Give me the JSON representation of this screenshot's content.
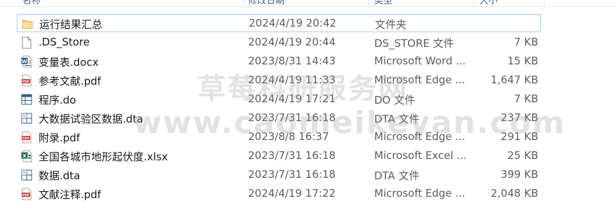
{
  "header": {
    "name": "名称",
    "date": "修改日期",
    "type": "类型",
    "size": "大小"
  },
  "files": [
    {
      "name": "运行结果汇总",
      "date": "2024/4/19 20:42",
      "type": "文件夹",
      "size": "",
      "icon": "folder-icon",
      "selected": true
    },
    {
      "name": ".DS_Store",
      "date": "2024/4/19 20:44",
      "type": "DS_STORE 文件",
      "size": "7 KB",
      "icon": "blank-file-icon"
    },
    {
      "name": "变量表.docx",
      "date": "2023/8/31 14:43",
      "type": "Microsoft Word ...",
      "size": "15 KB",
      "icon": "word-icon"
    },
    {
      "name": "参考文献.pdf",
      "date": "2024/4/19 11:33",
      "type": "Microsoft Edge ...",
      "size": "1,647 KB",
      "icon": "pdf-icon"
    },
    {
      "name": "程序.do",
      "date": "2024/4/19 17:21",
      "type": "DO 文件",
      "size": "7 KB",
      "icon": "stata-do-icon"
    },
    {
      "name": "大数据试验区数据.dta",
      "date": "2023/7/31 16:18",
      "type": "DTA 文件",
      "size": "237 KB",
      "icon": "stata-dta-icon"
    },
    {
      "name": "附录.pdf",
      "date": "2023/8/8 16:37",
      "type": "Microsoft Edge ...",
      "size": "291 KB",
      "icon": "pdf-icon"
    },
    {
      "name": "全国各城市地形起伏度.xlsx",
      "date": "2023/7/31 16:18",
      "type": "Microsoft Excel ...",
      "size": "25 KB",
      "icon": "excel-icon"
    },
    {
      "name": "数据.dta",
      "date": "2023/7/31 16:18",
      "type": "DTA 文件",
      "size": "399 KB",
      "icon": "stata-dta-icon"
    },
    {
      "name": "文献注释.pdf",
      "date": "2024/4/19 17:22",
      "type": "Microsoft Edge ...",
      "size": "2,048 KB",
      "icon": "pdf-icon"
    }
  ],
  "watermark": {
    "line1": "草莓科研服务网",
    "line2": "www.caomeikeyan.com"
  },
  "colors": {
    "selection_border": "#99d1ff",
    "folder": "#f8d775",
    "pdf": "#d9312b",
    "word": "#2b5797",
    "excel": "#1e7145",
    "stata": "#2f5d8a"
  }
}
